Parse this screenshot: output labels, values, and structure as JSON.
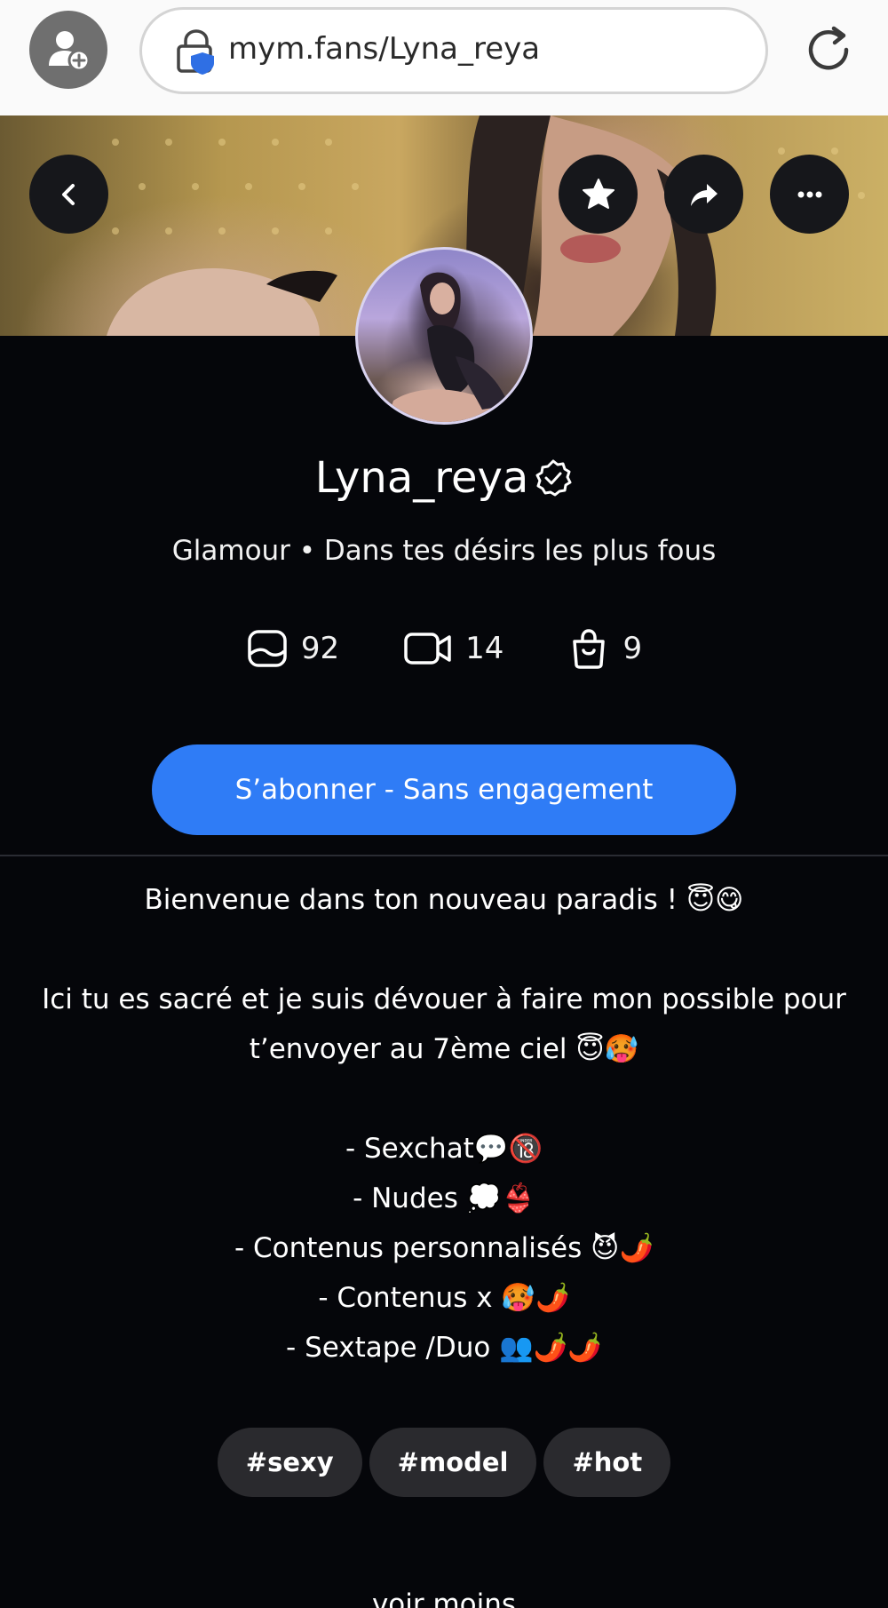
{
  "browser": {
    "url": "mym.fans/Lyna_reya"
  },
  "profile": {
    "name": "Lyna_reya",
    "tagline": "Glamour • Dans tes désirs les plus fous",
    "stats": [
      {
        "icon": "image-icon",
        "value": "92"
      },
      {
        "icon": "video-icon",
        "value": "14"
      },
      {
        "icon": "shopping-bag-icon",
        "value": "9"
      }
    ],
    "subscribe_label": "S’abonner - Sans engagement"
  },
  "bio": {
    "lines": [
      "Bienvenue dans ton nouveau paradis ! 😇😋",
      "",
      "Ici tu es sacré et je suis dévouer à faire mon possible pour t’envoyer au 7ème ciel 😇🥵",
      "",
      "- Sexchat💬🔞",
      "- Nudes 💭👙",
      "- Contenus personnalisés 😈🌶️",
      "- Contenus x 🥵🌶️",
      "- Sextape /Duo 👥🌶️🌶️"
    ]
  },
  "tags": [
    "#sexy",
    "#model",
    "#hot"
  ],
  "see_less_label": "voir moins",
  "colors": {
    "accent": "#2f7cf6",
    "background": "#05060a",
    "tag_bg": "#2a2a2e"
  }
}
